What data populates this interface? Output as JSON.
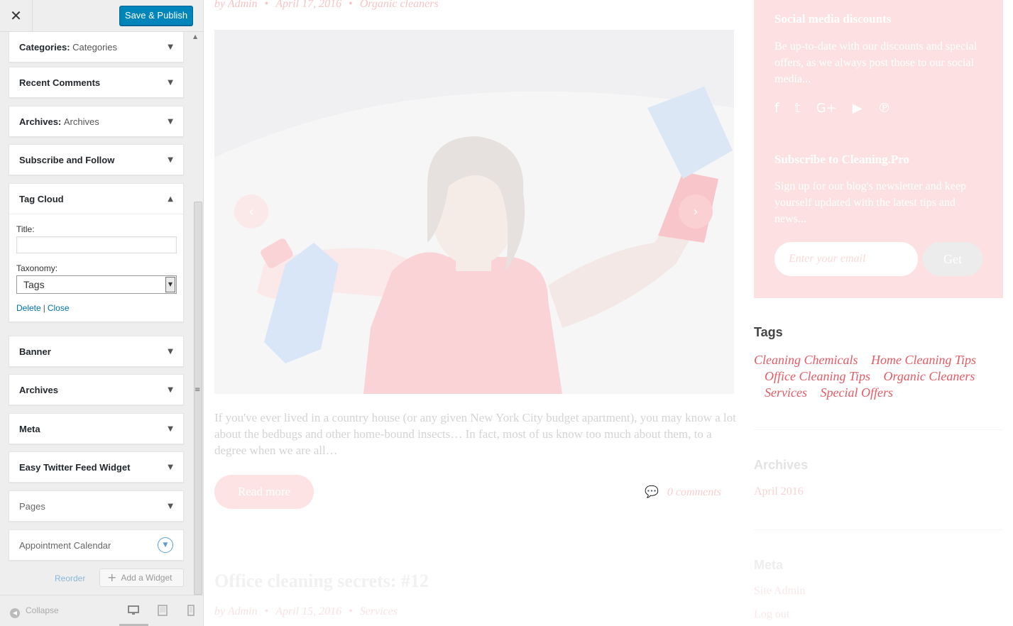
{
  "customizer": {
    "close_icon": "close-icon",
    "publish_label": "Save & Publish",
    "widgets": [
      {
        "title": "Categories",
        "subtitle": "Categories"
      },
      {
        "title": "Recent Comments",
        "subtitle": ""
      },
      {
        "title": "Archives",
        "subtitle": "Archives"
      },
      {
        "title": "Subscribe and Follow",
        "subtitle": ""
      },
      {
        "title": "Tag Cloud",
        "subtitle": ""
      },
      {
        "title": "Banner",
        "subtitle": ""
      },
      {
        "title": "Archives",
        "subtitle": ""
      },
      {
        "title": "Meta",
        "subtitle": ""
      },
      {
        "title": "Easy Twitter Feed Widget",
        "subtitle": ""
      },
      {
        "title": "Pages",
        "subtitle": ""
      },
      {
        "title": "Appointment Calendar",
        "subtitle": ""
      }
    ],
    "tag_cloud_form": {
      "title_label": "Title:",
      "title_value": "",
      "taxonomy_label": "Taxonomy:",
      "taxonomy_value": "Tags",
      "delete_label": "Delete",
      "separator": "|",
      "close_label": "Close"
    },
    "reorder_label": "Reorder",
    "add_widget_label": "Add a Widget",
    "collapse_label": "Collapse",
    "devices": [
      "desktop",
      "tablet",
      "mobile"
    ],
    "accent_color": "#0085ba"
  },
  "preview": {
    "post1_meta": {
      "author": "by Admin",
      "date": "April 17, 2016",
      "category": "Organic cleaners"
    },
    "excerpt": "If you've ever lived in a country house (or any given New York City budget apartment), you may know a lot about the bedbugs and other home-bound insects… In fact, most of us know too much about them, to a degree when we are all…",
    "read_more_label": "Read more",
    "comments_label": "0 comments",
    "post2_title": "Office cleaning secrets: #12",
    "post2_meta": {
      "author": "by Admin",
      "date": "April 15, 2016",
      "category": "Services"
    },
    "promo": {
      "social_title": "Social media discounts",
      "social_text": "Be up-to-date with our discounts and special offers, as we always post those to our social media...",
      "social_icons": [
        "facebook-icon",
        "twitter-icon",
        "google-plus-icon",
        "youtube-icon",
        "pinterest-icon"
      ],
      "subscribe_title": "Subscribe to Cleaning.Pro",
      "subscribe_text": "Sign up for our blog's newsletter and keep yourself updated with the latest tips and news...",
      "email_placeholder": "Enter your email",
      "get_label": "Get"
    },
    "tags_title": "Tags",
    "tags": [
      "Cleaning Chemicals",
      "Home Cleaning Tips",
      "Office Cleaning Tips",
      "Organic Cleaners",
      "Services",
      "Special Offers"
    ],
    "archives_title": "Archives",
    "archives_items": [
      "April 2016"
    ],
    "meta_title": "Meta",
    "meta_items": [
      "Site Admin",
      "Log out"
    ],
    "brand_color": "#e85a63"
  }
}
